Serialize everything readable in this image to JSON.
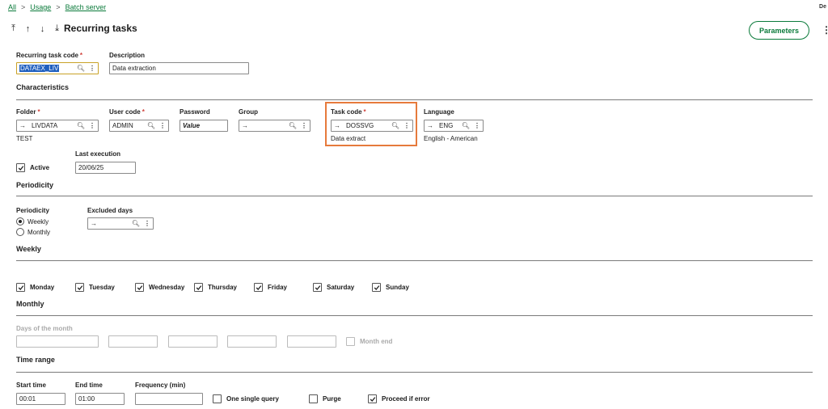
{
  "breadcrumb": {
    "all": "All",
    "usage": "Usage",
    "batch": "Batch server",
    "sep": ">"
  },
  "corner_text": "De",
  "toolbar": {
    "first": "⤒",
    "up": "↑",
    "down": "↓",
    "last": "⤓"
  },
  "page_title": "Recurring tasks",
  "parameters_label": "Parameters",
  "kebab": "⋮",
  "required_mark": "*",
  "icons": {
    "lookup": "🔍︎",
    "arrow": "→",
    "more": "⋮",
    "check_color": "#222222"
  },
  "header": {
    "task_code_label": "Recurring task code",
    "task_code_value": "DATAEX_LIV",
    "description_label": "Description",
    "description_value": "Data extraction"
  },
  "characteristics": {
    "title": "Characteristics",
    "folder_label": "Folder",
    "folder_value": "LIVDATA",
    "folder_desc": "TEST",
    "user_label": "User code",
    "user_value": "ADMIN",
    "password_label": "Password",
    "password_value": "Value",
    "group_label": "Group",
    "group_value": "",
    "taskcode_label": "Task code",
    "taskcode_value": "DOSSVG",
    "taskcode_desc": "Data extract",
    "language_label": "Language",
    "language_value": "ENG",
    "language_desc": "English - American",
    "last_exec_label": "Last execution",
    "last_exec_value": "20/06/25",
    "active_label": "Active",
    "active_checked": true
  },
  "periodicity": {
    "title": "Periodicity",
    "label": "Periodicity",
    "options": [
      "Weekly",
      "Monthly"
    ],
    "selected": "Weekly",
    "excluded_label": "Excluded days",
    "excluded_value": ""
  },
  "weekly": {
    "title": "Weekly",
    "days": [
      "Monday",
      "Tuesday",
      "Wednesday",
      "Thursday",
      "Friday",
      "Saturday",
      "Sunday"
    ],
    "checked": [
      true,
      true,
      true,
      true,
      true,
      true,
      true
    ]
  },
  "monthly": {
    "title": "Monthly",
    "days_label": "Days of the month",
    "month_end_label": "Month end"
  },
  "time_range": {
    "title": "Time range",
    "start_label": "Start time",
    "start_value": "00:01",
    "end_label": "End time",
    "end_value": "01:00",
    "freq_label": "Frequency (min)",
    "freq_value": "",
    "one_query_label": "One single query",
    "one_query_checked": false,
    "purge_label": "Purge",
    "purge_checked": false,
    "proceed_label": "Proceed if error",
    "proceed_checked": true
  },
  "highlight_color": "#e67a3c",
  "accent_color": "#0a7a3a"
}
